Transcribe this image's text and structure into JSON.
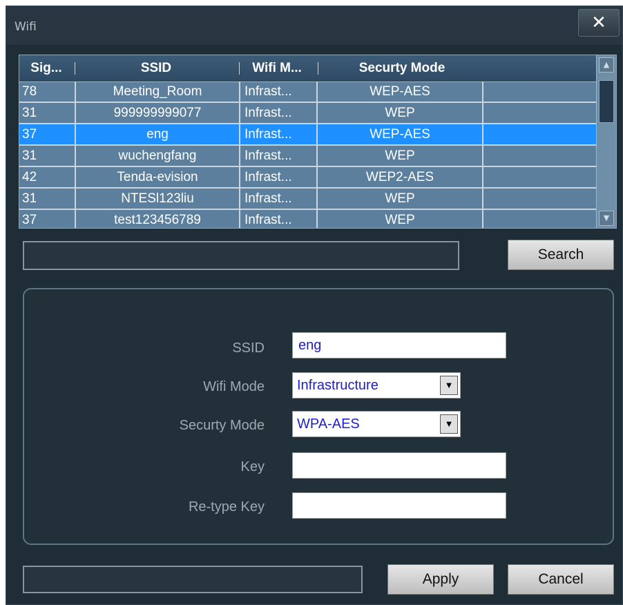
{
  "window": {
    "title": "Wifi",
    "close_glyph": "✕"
  },
  "table": {
    "columns": [
      "Sig...",
      "SSID",
      "Wifi M...",
      "Securty Mode"
    ],
    "rows": [
      {
        "signal": "78",
        "ssid": "Meeting_Room",
        "mode": "Infrast...",
        "security": "WEP-AES"
      },
      {
        "signal": "31",
        "ssid": "999999999077",
        "mode": "Infrast...",
        "security": "WEP"
      },
      {
        "signal": "37",
        "ssid": "eng",
        "mode": "Infrast...",
        "security": "WEP-AES"
      },
      {
        "signal": "31",
        "ssid": "wuchengfang",
        "mode": "Infrast...",
        "security": "WEP"
      },
      {
        "signal": "42",
        "ssid": "Tenda-evision",
        "mode": "Infrast...",
        "security": "WEP2-AES"
      },
      {
        "signal": "31",
        "ssid": "NTESl123liu",
        "mode": "Infrast...",
        "security": "WEP"
      },
      {
        "signal": "37",
        "ssid": "test123456789",
        "mode": "Infrast...",
        "security": "WEP"
      }
    ],
    "selected_row": 2
  },
  "search": {
    "value": "",
    "button_label": "Search"
  },
  "form": {
    "ssid_label": "SSID",
    "ssid_value": "eng",
    "wifi_mode_label": "Wifi Mode",
    "wifi_mode_value": "Infrastructure",
    "security_mode_label": "Securty Mode",
    "security_mode_value": "WPA-AES",
    "key_label": "Key",
    "key_value": "",
    "retype_key_label": "Re-type Key",
    "retype_key_value": ""
  },
  "footer": {
    "status": "",
    "apply_label": "Apply",
    "cancel_label": "Cancel"
  },
  "icons": {
    "close": "close-icon",
    "dropdown": "chevron-down-icon",
    "scroll_up": "arrow-up-icon",
    "scroll_down": "arrow-down-icon"
  },
  "colors": {
    "selection": "#1e90ff",
    "table_bg": "#5b7f9c",
    "window_bg": "#1f2d36",
    "field_text": "#2020c8"
  }
}
